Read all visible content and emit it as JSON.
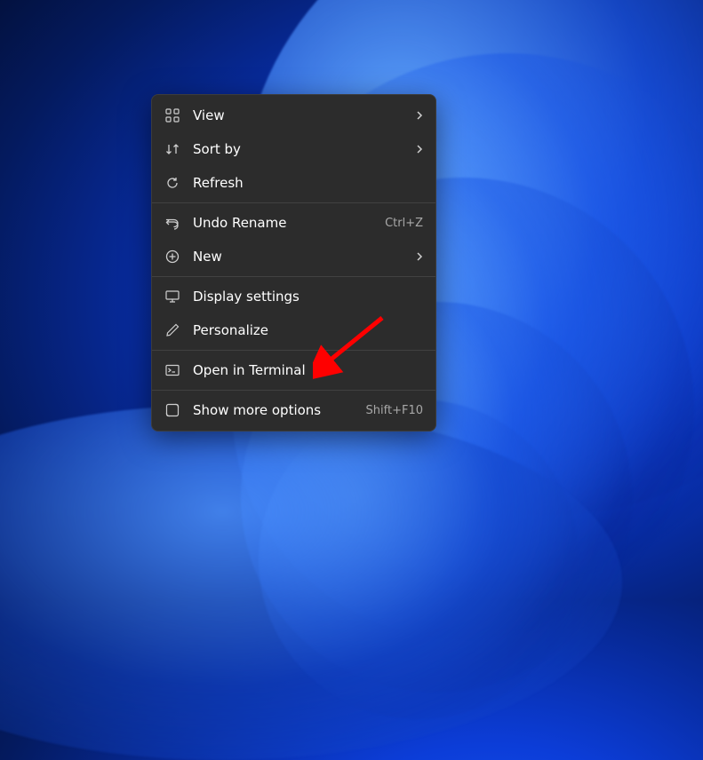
{
  "context_menu": {
    "groups": [
      [
        {
          "icon": "view",
          "label": "View",
          "submenu": true
        },
        {
          "icon": "sort",
          "label": "Sort by",
          "submenu": true
        },
        {
          "icon": "refresh",
          "label": "Refresh"
        }
      ],
      [
        {
          "icon": "undo",
          "label": "Undo Rename",
          "shortcut": "Ctrl+Z"
        },
        {
          "icon": "new",
          "label": "New",
          "submenu": true
        }
      ],
      [
        {
          "icon": "display",
          "label": "Display settings"
        },
        {
          "icon": "personalize",
          "label": "Personalize"
        }
      ],
      [
        {
          "icon": "terminal",
          "label": "Open in Terminal"
        }
      ],
      [
        {
          "icon": "moreopts",
          "label": "Show more options",
          "shortcut": "Shift+F10"
        }
      ]
    ]
  },
  "annotation": {
    "type": "red-arrow",
    "target": "Open in Terminal"
  }
}
